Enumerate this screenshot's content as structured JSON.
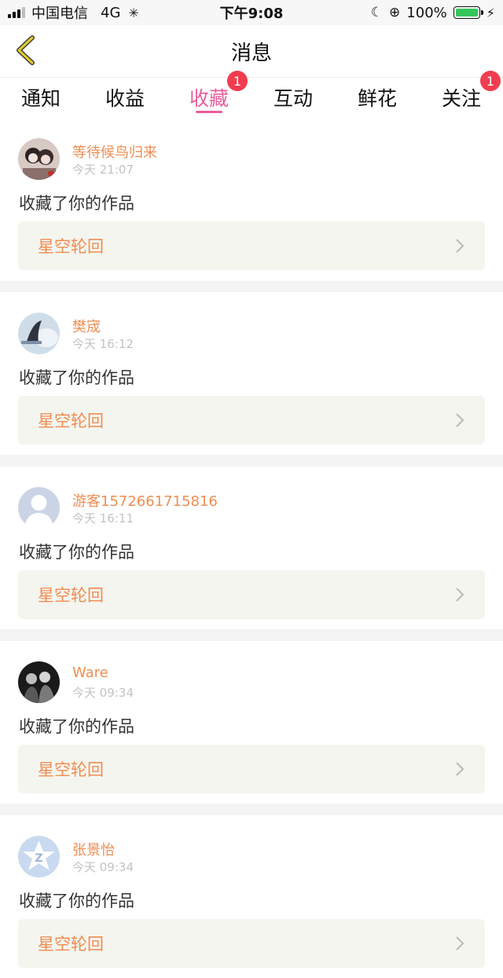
{
  "status_bar": {
    "carrier": "中国电信",
    "network": "4G",
    "time": "下午9:08",
    "battery": "100%"
  },
  "nav": {
    "title": "消息",
    "back_icon": "chevron-left-icon"
  },
  "tabs": [
    {
      "label": "通知",
      "badge": null,
      "active": false
    },
    {
      "label": "收益",
      "badge": null,
      "active": false
    },
    {
      "label": "收藏",
      "badge": "1",
      "active": true
    },
    {
      "label": "互动",
      "badge": null,
      "active": false
    },
    {
      "label": "鲜花",
      "badge": null,
      "active": false
    },
    {
      "label": "关注",
      "badge": "1",
      "active": false
    }
  ],
  "messages": [
    {
      "user": "等待候鸟归来",
      "time": "今天 21:07",
      "action": "收藏了你的作品",
      "work": "星空轮回"
    },
    {
      "user": "樊宬",
      "time": "今天 16:12",
      "action": "收藏了你的作品",
      "work": "星空轮回"
    },
    {
      "user": "游客1572661715816",
      "time": "今天 16:11",
      "action": "收藏了你的作品",
      "work": "星空轮回"
    },
    {
      "user": "Ware",
      "time": "今天 09:34",
      "action": "收藏了你的作品",
      "work": "星空轮回"
    },
    {
      "user": "张景怡",
      "time": "今天 09:34",
      "action": "收藏了你的作品",
      "work": "星空轮回"
    }
  ],
  "colors": {
    "accent": "#e95d9b",
    "username": "#f08d52",
    "badge": "#f03d4f",
    "back_icon": "#d4c21c"
  }
}
